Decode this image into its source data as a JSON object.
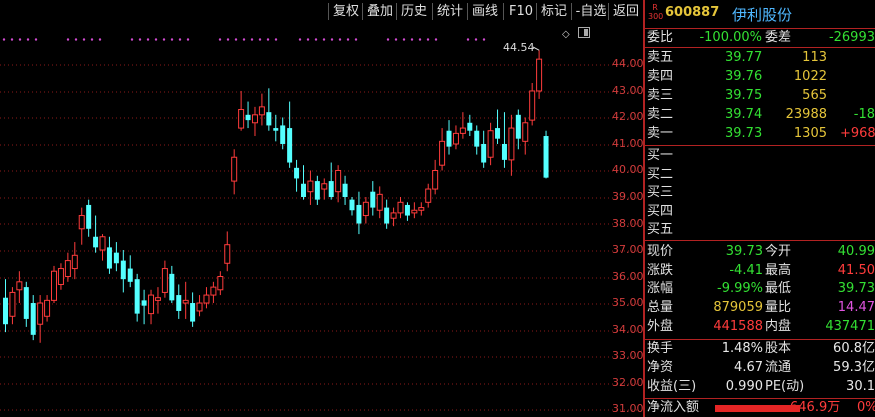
{
  "toolbar": {
    "buttons": [
      "复权",
      "叠加",
      "历史",
      "统计",
      "画线",
      "F10",
      "标记",
      "-自选",
      "返回"
    ]
  },
  "chart": {
    "y_ticks": [
      "44.00",
      "43.00",
      "42.00",
      "41.00",
      "40.00",
      "39.00",
      "38.00",
      "37.00",
      "36.00",
      "35.00",
      "34.00",
      "33.00",
      "32.00",
      "31.00"
    ],
    "tag": "44.54",
    "colors": {
      "up": "#ff3c3c",
      "down": "#54ffff",
      "grid": "#8b1a1a",
      "avg_dots": "#d24bd2"
    }
  },
  "chart_data": {
    "type": "candlestick",
    "ylim": [
      30.7,
      45.3
    ],
    "max_label": "44.54",
    "candles": [
      {
        "o": 35.2,
        "h": 35.9,
        "l": 33.9,
        "c": 34.2
      },
      {
        "o": 34.5,
        "h": 35.6,
        "l": 34.2,
        "c": 35.4
      },
      {
        "o": 35.5,
        "h": 36.2,
        "l": 35.0,
        "c": 35.8
      },
      {
        "o": 35.6,
        "h": 35.8,
        "l": 34.1,
        "c": 34.4
      },
      {
        "o": 35.0,
        "h": 35.3,
        "l": 33.6,
        "c": 33.8
      },
      {
        "o": 34.2,
        "h": 35.3,
        "l": 33.5,
        "c": 35.0
      },
      {
        "o": 34.5,
        "h": 35.3,
        "l": 34.3,
        "c": 35.1
      },
      {
        "o": 35.1,
        "h": 36.4,
        "l": 35.0,
        "c": 36.2
      },
      {
        "o": 35.7,
        "h": 36.5,
        "l": 35.5,
        "c": 36.3
      },
      {
        "o": 36.0,
        "h": 36.9,
        "l": 35.8,
        "c": 36.6
      },
      {
        "o": 36.3,
        "h": 37.3,
        "l": 35.9,
        "c": 36.8
      },
      {
        "o": 37.8,
        "h": 38.6,
        "l": 37.2,
        "c": 38.3
      },
      {
        "o": 38.7,
        "h": 38.9,
        "l": 37.5,
        "c": 37.8
      },
      {
        "o": 37.5,
        "h": 38.3,
        "l": 36.9,
        "c": 37.1
      },
      {
        "o": 37.0,
        "h": 37.6,
        "l": 36.6,
        "c": 37.5
      },
      {
        "o": 37.1,
        "h": 37.5,
        "l": 36.1,
        "c": 36.3
      },
      {
        "o": 36.9,
        "h": 37.3,
        "l": 36.2,
        "c": 36.5
      },
      {
        "o": 36.6,
        "h": 37.0,
        "l": 35.4,
        "c": 35.9
      },
      {
        "o": 36.3,
        "h": 36.8,
        "l": 35.6,
        "c": 35.8
      },
      {
        "o": 35.9,
        "h": 36.1,
        "l": 34.3,
        "c": 34.6
      },
      {
        "o": 35.1,
        "h": 35.5,
        "l": 34.2,
        "c": 34.9
      },
      {
        "o": 34.6,
        "h": 35.5,
        "l": 34.2,
        "c": 35.3
      },
      {
        "o": 35.1,
        "h": 35.6,
        "l": 34.6,
        "c": 35.2
      },
      {
        "o": 35.4,
        "h": 36.6,
        "l": 35.2,
        "c": 36.3
      },
      {
        "o": 36.1,
        "h": 36.4,
        "l": 35.0,
        "c": 35.1
      },
      {
        "o": 35.3,
        "h": 35.7,
        "l": 34.4,
        "c": 34.7
      },
      {
        "o": 35.0,
        "h": 35.8,
        "l": 34.4,
        "c": 35.1
      },
      {
        "o": 35.0,
        "h": 35.4,
        "l": 34.1,
        "c": 34.3
      },
      {
        "o": 34.7,
        "h": 35.3,
        "l": 34.5,
        "c": 35.0
      },
      {
        "o": 35.0,
        "h": 35.6,
        "l": 34.8,
        "c": 35.3
      },
      {
        "o": 35.3,
        "h": 35.8,
        "l": 35.0,
        "c": 35.6
      },
      {
        "o": 35.5,
        "h": 36.2,
        "l": 35.3,
        "c": 36.0
      },
      {
        "o": 36.5,
        "h": 37.7,
        "l": 36.2,
        "c": 37.2
      },
      {
        "o": 39.6,
        "h": 40.8,
        "l": 39.1,
        "c": 40.5
      },
      {
        "o": 41.6,
        "h": 43.0,
        "l": 41.5,
        "c": 42.3
      },
      {
        "o": 42.1,
        "h": 42.6,
        "l": 41.6,
        "c": 41.9
      },
      {
        "o": 41.8,
        "h": 42.4,
        "l": 41.3,
        "c": 42.1
      },
      {
        "o": 42.1,
        "h": 42.9,
        "l": 41.7,
        "c": 42.4
      },
      {
        "o": 42.2,
        "h": 43.1,
        "l": 41.5,
        "c": 41.7
      },
      {
        "o": 41.6,
        "h": 42.1,
        "l": 41.1,
        "c": 41.5
      },
      {
        "o": 41.7,
        "h": 42.0,
        "l": 40.8,
        "c": 41.0
      },
      {
        "o": 41.6,
        "h": 42.6,
        "l": 40.1,
        "c": 40.3
      },
      {
        "o": 40.1,
        "h": 40.4,
        "l": 39.2,
        "c": 39.7
      },
      {
        "o": 39.5,
        "h": 40.2,
        "l": 38.9,
        "c": 39.0
      },
      {
        "o": 39.2,
        "h": 40.0,
        "l": 38.7,
        "c": 39.6
      },
      {
        "o": 39.6,
        "h": 39.8,
        "l": 38.7,
        "c": 38.9
      },
      {
        "o": 39.3,
        "h": 39.7,
        "l": 38.9,
        "c": 39.5
      },
      {
        "o": 39.6,
        "h": 40.3,
        "l": 38.9,
        "c": 39.0
      },
      {
        "o": 39.2,
        "h": 40.2,
        "l": 38.8,
        "c": 40.0
      },
      {
        "o": 39.5,
        "h": 39.8,
        "l": 38.7,
        "c": 39.0
      },
      {
        "o": 38.9,
        "h": 39.0,
        "l": 38.3,
        "c": 38.5
      },
      {
        "o": 38.7,
        "h": 39.2,
        "l": 37.6,
        "c": 38.0
      },
      {
        "o": 38.3,
        "h": 39.0,
        "l": 38.0,
        "c": 38.8
      },
      {
        "o": 39.2,
        "h": 39.6,
        "l": 38.3,
        "c": 38.6
      },
      {
        "o": 38.5,
        "h": 39.4,
        "l": 38.2,
        "c": 39.1
      },
      {
        "o": 38.6,
        "h": 38.9,
        "l": 37.8,
        "c": 38.0
      },
      {
        "o": 38.2,
        "h": 38.6,
        "l": 37.9,
        "c": 38.4
      },
      {
        "o": 38.4,
        "h": 39.0,
        "l": 38.2,
        "c": 38.8
      },
      {
        "o": 38.7,
        "h": 38.8,
        "l": 38.1,
        "c": 38.3
      },
      {
        "o": 38.4,
        "h": 38.8,
        "l": 38.2,
        "c": 38.5
      },
      {
        "o": 38.5,
        "h": 38.8,
        "l": 38.3,
        "c": 38.6
      },
      {
        "o": 38.8,
        "h": 39.5,
        "l": 38.6,
        "c": 39.3
      },
      {
        "o": 39.3,
        "h": 40.4,
        "l": 39.1,
        "c": 40.0
      },
      {
        "o": 40.2,
        "h": 41.6,
        "l": 40.0,
        "c": 41.1
      },
      {
        "o": 41.5,
        "h": 41.9,
        "l": 40.6,
        "c": 40.9
      },
      {
        "o": 41.0,
        "h": 41.7,
        "l": 40.8,
        "c": 41.4
      },
      {
        "o": 41.4,
        "h": 42.2,
        "l": 41.2,
        "c": 41.6
      },
      {
        "o": 41.8,
        "h": 42.1,
        "l": 41.3,
        "c": 41.5
      },
      {
        "o": 41.5,
        "h": 41.7,
        "l": 40.6,
        "c": 40.9
      },
      {
        "o": 41.0,
        "h": 41.5,
        "l": 40.1,
        "c": 40.3
      },
      {
        "o": 40.5,
        "h": 41.8,
        "l": 40.2,
        "c": 41.5
      },
      {
        "o": 41.6,
        "h": 42.3,
        "l": 41.0,
        "c": 41.2
      },
      {
        "o": 41.0,
        "h": 42.2,
        "l": 40.1,
        "c": 40.4
      },
      {
        "o": 40.4,
        "h": 42.1,
        "l": 39.8,
        "c": 41.6
      },
      {
        "o": 42.1,
        "h": 42.3,
        "l": 40.8,
        "c": 41.2
      },
      {
        "o": 41.1,
        "h": 42.0,
        "l": 40.6,
        "c": 41.8
      },
      {
        "o": 41.9,
        "h": 43.3,
        "l": 41.7,
        "c": 43.0
      },
      {
        "o": 43.0,
        "h": 44.54,
        "l": 42.7,
        "c": 44.2
      },
      {
        "o": 41.3,
        "h": 41.5,
        "l": 39.7,
        "c": 39.73
      }
    ]
  },
  "panel": {
    "exchange": "R\n300",
    "code": "600887",
    "name": "伊利股份",
    "wei": {
      "l1": "委比",
      "v1": "-100.00%",
      "l2": "委差",
      "v2": "-26993"
    },
    "asks": [
      {
        "label": "卖五",
        "price": "39.77",
        "vol": "113",
        "chg": ""
      },
      {
        "label": "卖四",
        "price": "39.76",
        "vol": "1022",
        "chg": ""
      },
      {
        "label": "卖三",
        "price": "39.75",
        "vol": "565",
        "chg": ""
      },
      {
        "label": "卖二",
        "price": "39.74",
        "vol": "23988",
        "chg": "-18"
      },
      {
        "label": "卖一",
        "price": "39.73",
        "vol": "1305",
        "chg": "+968"
      }
    ],
    "bids": [
      "买一",
      "买二",
      "买三",
      "买四",
      "买五"
    ],
    "stats": [
      {
        "l1": "现价",
        "v1": "39.73",
        "l2": "今开",
        "v2": "40.99"
      },
      {
        "l1": "涨跌",
        "v1": "-4.41",
        "l2": "最高",
        "v2": "41.50"
      },
      {
        "l1": "涨幅",
        "v1": "-9.99%",
        "l2": "最低",
        "v2": "39.73"
      },
      {
        "l1": "总量",
        "v1": "879059",
        "l2": "量比",
        "v2": "14.47"
      },
      {
        "l1": "外盘",
        "v1": "441588",
        "l2": "内盘",
        "v2": "437471"
      }
    ],
    "fin": [
      {
        "l1": "换手",
        "v1": "1.48%",
        "l2": "股本",
        "v2": "60.8亿"
      },
      {
        "l1": "净资",
        "v1": "4.67",
        "l2": "流通",
        "v2": "59.3亿"
      },
      {
        "l1": "收益(三)",
        "v1": "0.990",
        "l2": "PE(动)",
        "v2": "30.1"
      }
    ],
    "inflow": {
      "label": "净流入额",
      "value": "646.9万",
      "pct": "0%"
    }
  }
}
